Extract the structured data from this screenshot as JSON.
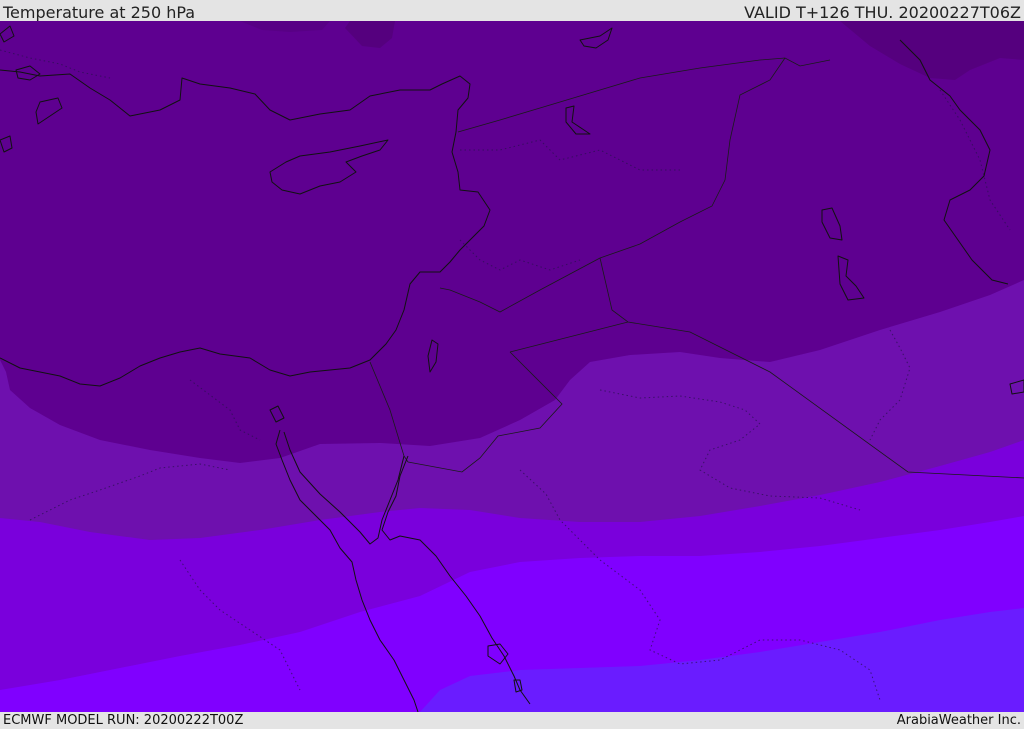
{
  "header": {
    "title": "Temperature at 250 hPa",
    "valid_time": "VALID T+126 THU. 20200227T06Z"
  },
  "footer": {
    "model_run": "ECMWF MODEL RUN: 20200222T00Z",
    "credit": "ArabiaWeather Inc."
  },
  "map": {
    "variable": "temperature",
    "pressure_level": "250 hPa",
    "colors": {
      "coldest_band": "#5e0090",
      "cold_band": "#6e10ae",
      "mid_band": "#7a00dc",
      "warm_band": "#8000ff",
      "warmest_band": "#6a1cff",
      "northeast_patch": "#55007e",
      "coastline": "#111111"
    }
  }
}
